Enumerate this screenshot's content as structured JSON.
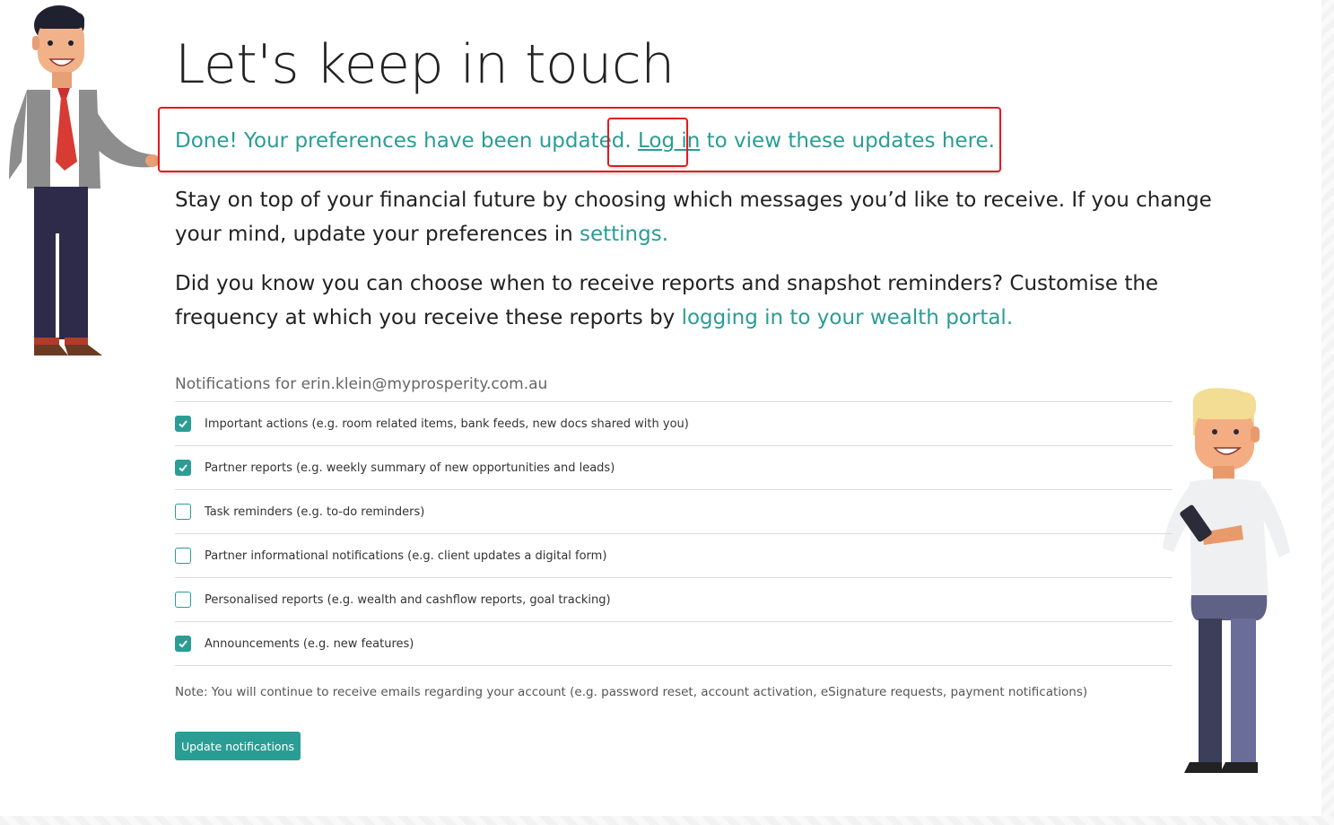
{
  "page": {
    "title": "Let's keep in touch",
    "success": {
      "text_before": "Done! Your preferences have been updated. ",
      "link": "Log in",
      "text_after": " to view these updates here."
    },
    "intro": {
      "p1_text": "Stay on top of your financial future by choosing which messages you’d like to receive. If you change your mind, update your preferences in ",
      "p1_link": "settings.",
      "p2_text": "Did you know you can choose when to receive reports and snapshot reminders? Customise the frequency at which you receive these reports by ",
      "p2_link": "logging in to your wealth portal."
    }
  },
  "notifications": {
    "heading": "Notifications for erin.klein@myprosperity.com.au",
    "items": [
      {
        "label": "Important actions (e.g. room related items, bank feeds, new docs shared with you)",
        "checked": true
      },
      {
        "label": "Partner reports (e.g. weekly summary of new opportunities and leads)",
        "checked": true
      },
      {
        "label": "Task reminders (e.g. to-do reminders)",
        "checked": false
      },
      {
        "label": "Partner informational notifications (e.g. client updates a digital form)",
        "checked": false
      },
      {
        "label": "Personalised reports (e.g. wealth and cashflow reports, goal tracking)",
        "checked": false
      },
      {
        "label": "Announcements (e.g. new features)",
        "checked": true
      }
    ],
    "note": "Note: You will continue to receive emails regarding your account (e.g. password reset, account activation, eSignature requests, payment notifications)",
    "button_label": "Update notifications"
  },
  "colors": {
    "accent": "#2a9d95",
    "highlight": "#e01b24"
  }
}
